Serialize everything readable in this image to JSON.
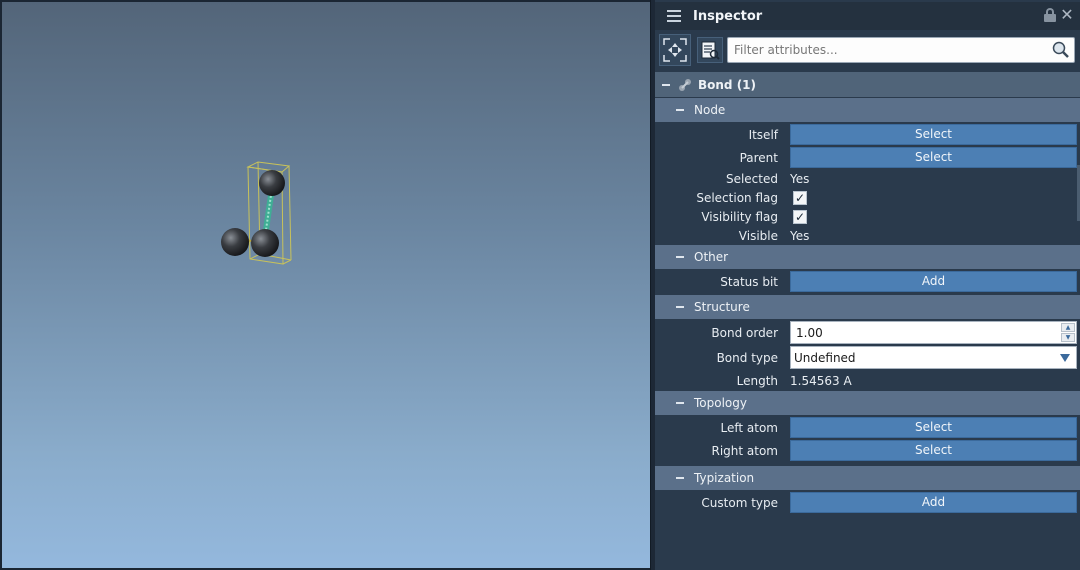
{
  "inspector": {
    "title": "Inspector",
    "filter_placeholder": "Filter attributes...",
    "bond_group": "Bond (1)",
    "node": {
      "header": "Node",
      "itself_label": "Itself",
      "itself_button": "Select",
      "parent_label": "Parent",
      "parent_button": "Select",
      "selected_label": "Selected",
      "selected_value": "Yes",
      "selection_flag_label": "Selection flag",
      "selection_flag_checked": true,
      "visibility_flag_label": "Visibility flag",
      "visibility_flag_checked": true,
      "visible_label": "Visible",
      "visible_value": "Yes"
    },
    "other": {
      "header": "Other",
      "status_bit_label": "Status bit",
      "status_bit_button": "Add"
    },
    "structure": {
      "header": "Structure",
      "bond_order_label": "Bond order",
      "bond_order_value": "1.00",
      "bond_type_label": "Bond type",
      "bond_type_value": "Undefined",
      "length_label": "Length",
      "length_value": "1.54563 A"
    },
    "topology": {
      "header": "Topology",
      "left_atom_label": "Left atom",
      "left_atom_button": "Select",
      "right_atom_label": "Right atom",
      "right_atom_button": "Select"
    },
    "typization": {
      "header": "Typization",
      "custom_type_label": "Custom type",
      "custom_type_button": "Add"
    }
  },
  "colors": {
    "button": "#4c7fb4",
    "group_header": "#5b708a",
    "panel_bg": "#2a3a4c",
    "bond_highlight": "#3fae95",
    "selection_box": "#c8c25a"
  },
  "icons": {
    "menu": "hamburger-icon",
    "lock": "lock-icon",
    "close": "close-icon",
    "select_all": "select-all-icon",
    "properties": "properties-icon",
    "search": "search-icon",
    "bond": "bond-icon"
  }
}
